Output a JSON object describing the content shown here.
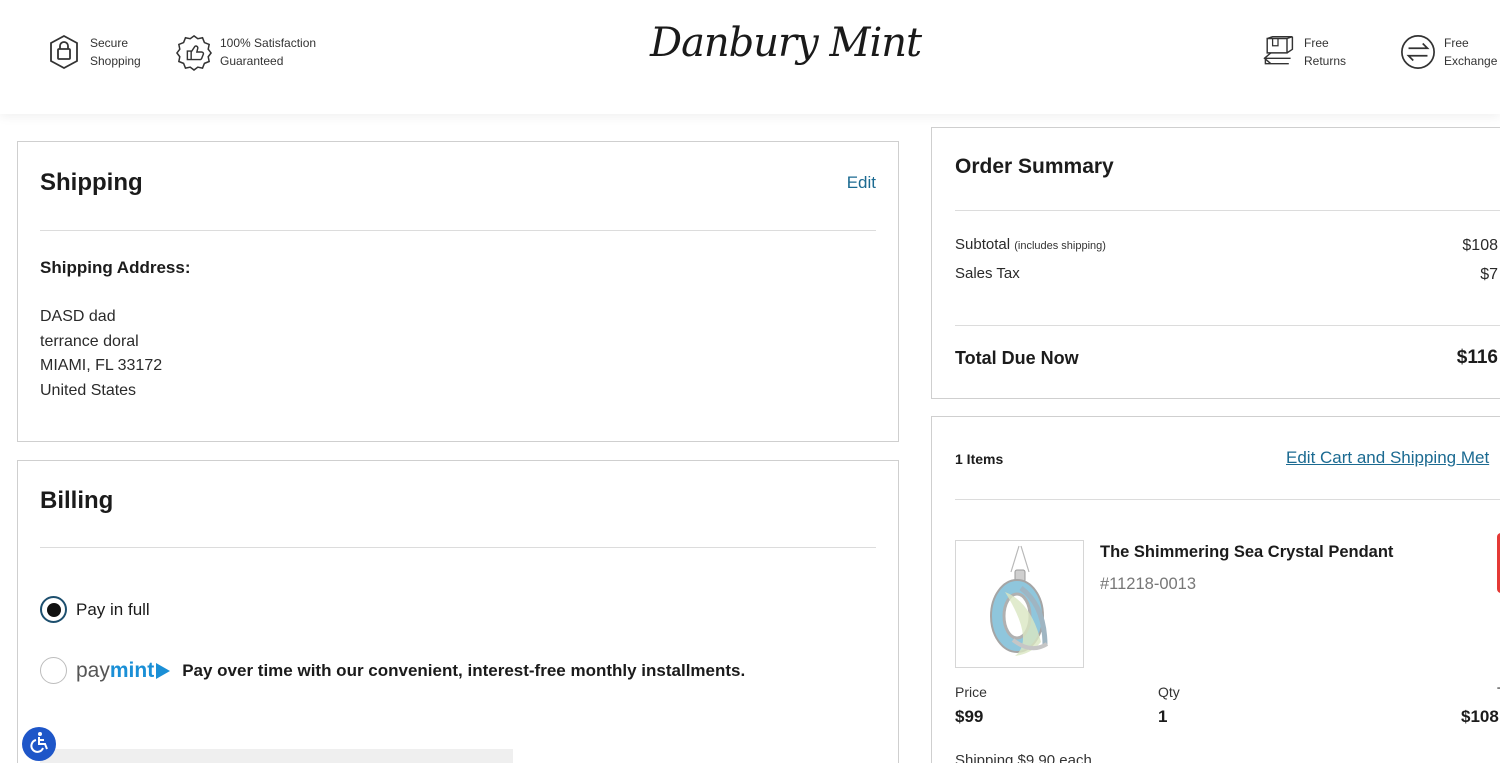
{
  "header": {
    "logo_text": "Danbury Mint",
    "badges": [
      {
        "icon": "lock-icon",
        "line1": "Secure",
        "line2": "Shopping"
      },
      {
        "icon": "thumbs-up-badge-icon",
        "line1": "100% Satisfaction",
        "line2": "Guaranteed"
      },
      {
        "icon": "return-box-icon",
        "line1": "Free",
        "line2": "Returns"
      },
      {
        "icon": "exchange-arrows-icon",
        "line1": "Free",
        "line2": "Exchange"
      }
    ]
  },
  "shipping": {
    "title": "Shipping",
    "edit_label": "Edit",
    "address_label": "Shipping Address:",
    "address_lines": [
      "DASD dad",
      "terrance doral",
      "MIAMI, FL 33172",
      "United States"
    ]
  },
  "billing": {
    "title": "Billing",
    "option_full": "Pay in full",
    "option_full_selected": true,
    "paymint_pay": "pay",
    "paymint_mint": "mint",
    "paymint_desc": "Pay over time with our convenient, interest-free monthly installments."
  },
  "summary": {
    "title": "Order Summary",
    "subtotal_label": "Subtotal",
    "subtotal_note": "(includes shipping)",
    "subtotal_value": "$108",
    "tax_label": "Sales Tax",
    "tax_value": "$7",
    "total_label": "Total Due Now",
    "total_value": "$116"
  },
  "cart": {
    "count_label": "1 Items",
    "edit_link": "Edit Cart and Shipping Met",
    "product": {
      "name": "The Shimmering Sea Crystal Pendant",
      "sku": "#11218-0013",
      "price_label": "Price",
      "price_value": "$99",
      "qty_label": "Qty",
      "qty_value": "1",
      "total_label": "T",
      "total_value": "$108",
      "shipping_note": "Shipping $9.90 each"
    }
  },
  "colors": {
    "link": "#1b6a91",
    "paymint_blue": "#1a8fd6",
    "accessibility_blue": "#1e56c8"
  }
}
